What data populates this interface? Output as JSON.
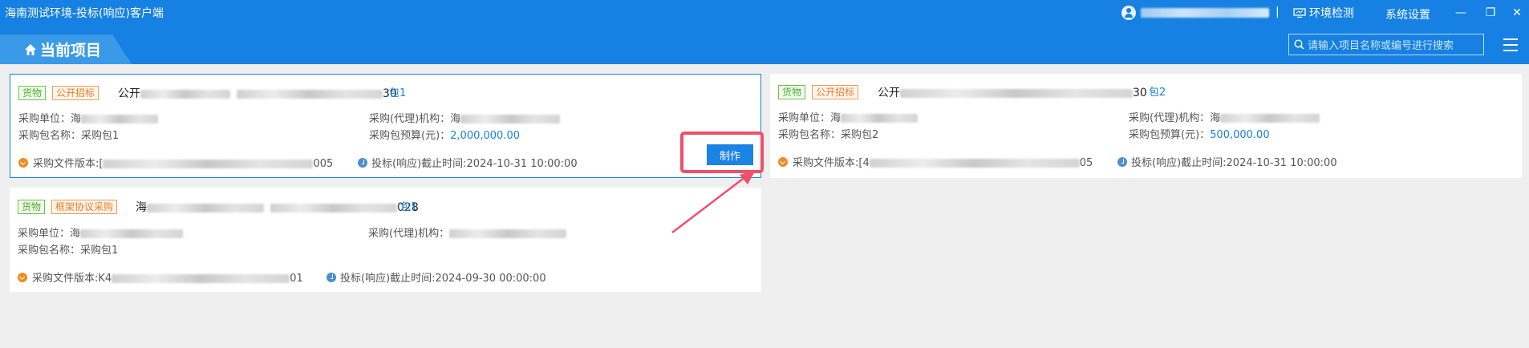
{
  "titlebar": {
    "app_title": "海南测试环境-投标(响应)客户端",
    "separator": "|",
    "env_check": "环境检测",
    "settings": "系统设置",
    "minimize": "—",
    "restore": "❐",
    "close": "✕"
  },
  "nav": {
    "current_tab": "当前项目",
    "search_placeholder": "请输入项目名称或编号进行搜索"
  },
  "projects": [
    {
      "goods_tag": "货物",
      "method_tag": "公开招标",
      "title_prefix": "公开",
      "title_suffix": "30",
      "package": "包1",
      "purchaser_label": "采购单位：",
      "purchaser_value": "海",
      "agency_label": "采购(代理)机构：",
      "agency_value": "海",
      "package_name_label": "采购包名称：",
      "package_name_value": "采购包1",
      "budget_label": "采购包预算(元)：",
      "budget_value": "2,000,000.00",
      "doc_version_label": "采购文件版本:",
      "doc_version_prefix": "[",
      "doc_version_suffix": "005",
      "deadline_label": "投标(响应)截止时间:",
      "deadline_value": "2024-10-31 10:00:00",
      "make_button": "制作"
    },
    {
      "goods_tag": "货物",
      "method_tag": "公开招标",
      "title_prefix": "公开",
      "title_suffix": "30",
      "package": "包2",
      "purchaser_label": "采购单位：",
      "purchaser_value": "海",
      "agency_label": "采购(代理)机构：",
      "agency_value": "海",
      "package_name_label": "采购包名称：",
      "package_name_value": "采购包2",
      "budget_label": "采购包预算(元)：",
      "budget_value": "500,000.00",
      "doc_version_label": "采购文件版本:",
      "doc_version_prefix": "[4",
      "doc_version_suffix": "05",
      "deadline_label": "投标(响应)截止时间:",
      "deadline_value": "2024-10-31 10:00:00"
    },
    {
      "goods_tag": "货物",
      "method_tag": "框架协议采购",
      "title_prefix": "海",
      "title_suffix": "028",
      "package": "包1",
      "purchaser_label": "采购单位：",
      "purchaser_value": "海",
      "agency_label": "采购(代理)机构：",
      "agency_value": "",
      "package_name_label": "采购包名称：",
      "package_name_value": "采购包1",
      "doc_version_label": "采购文件版本:",
      "doc_version_prefix": "K4",
      "doc_version_suffix": "01",
      "deadline_label": "投标(响应)截止时间:",
      "deadline_value": "2024-09-30 00:00:00"
    }
  ],
  "colors": {
    "brand_blue": "#1681e2",
    "highlight_red": "#ef4f6a",
    "goods_green": "#4cae2c",
    "method_orange": "#ee7a22"
  }
}
